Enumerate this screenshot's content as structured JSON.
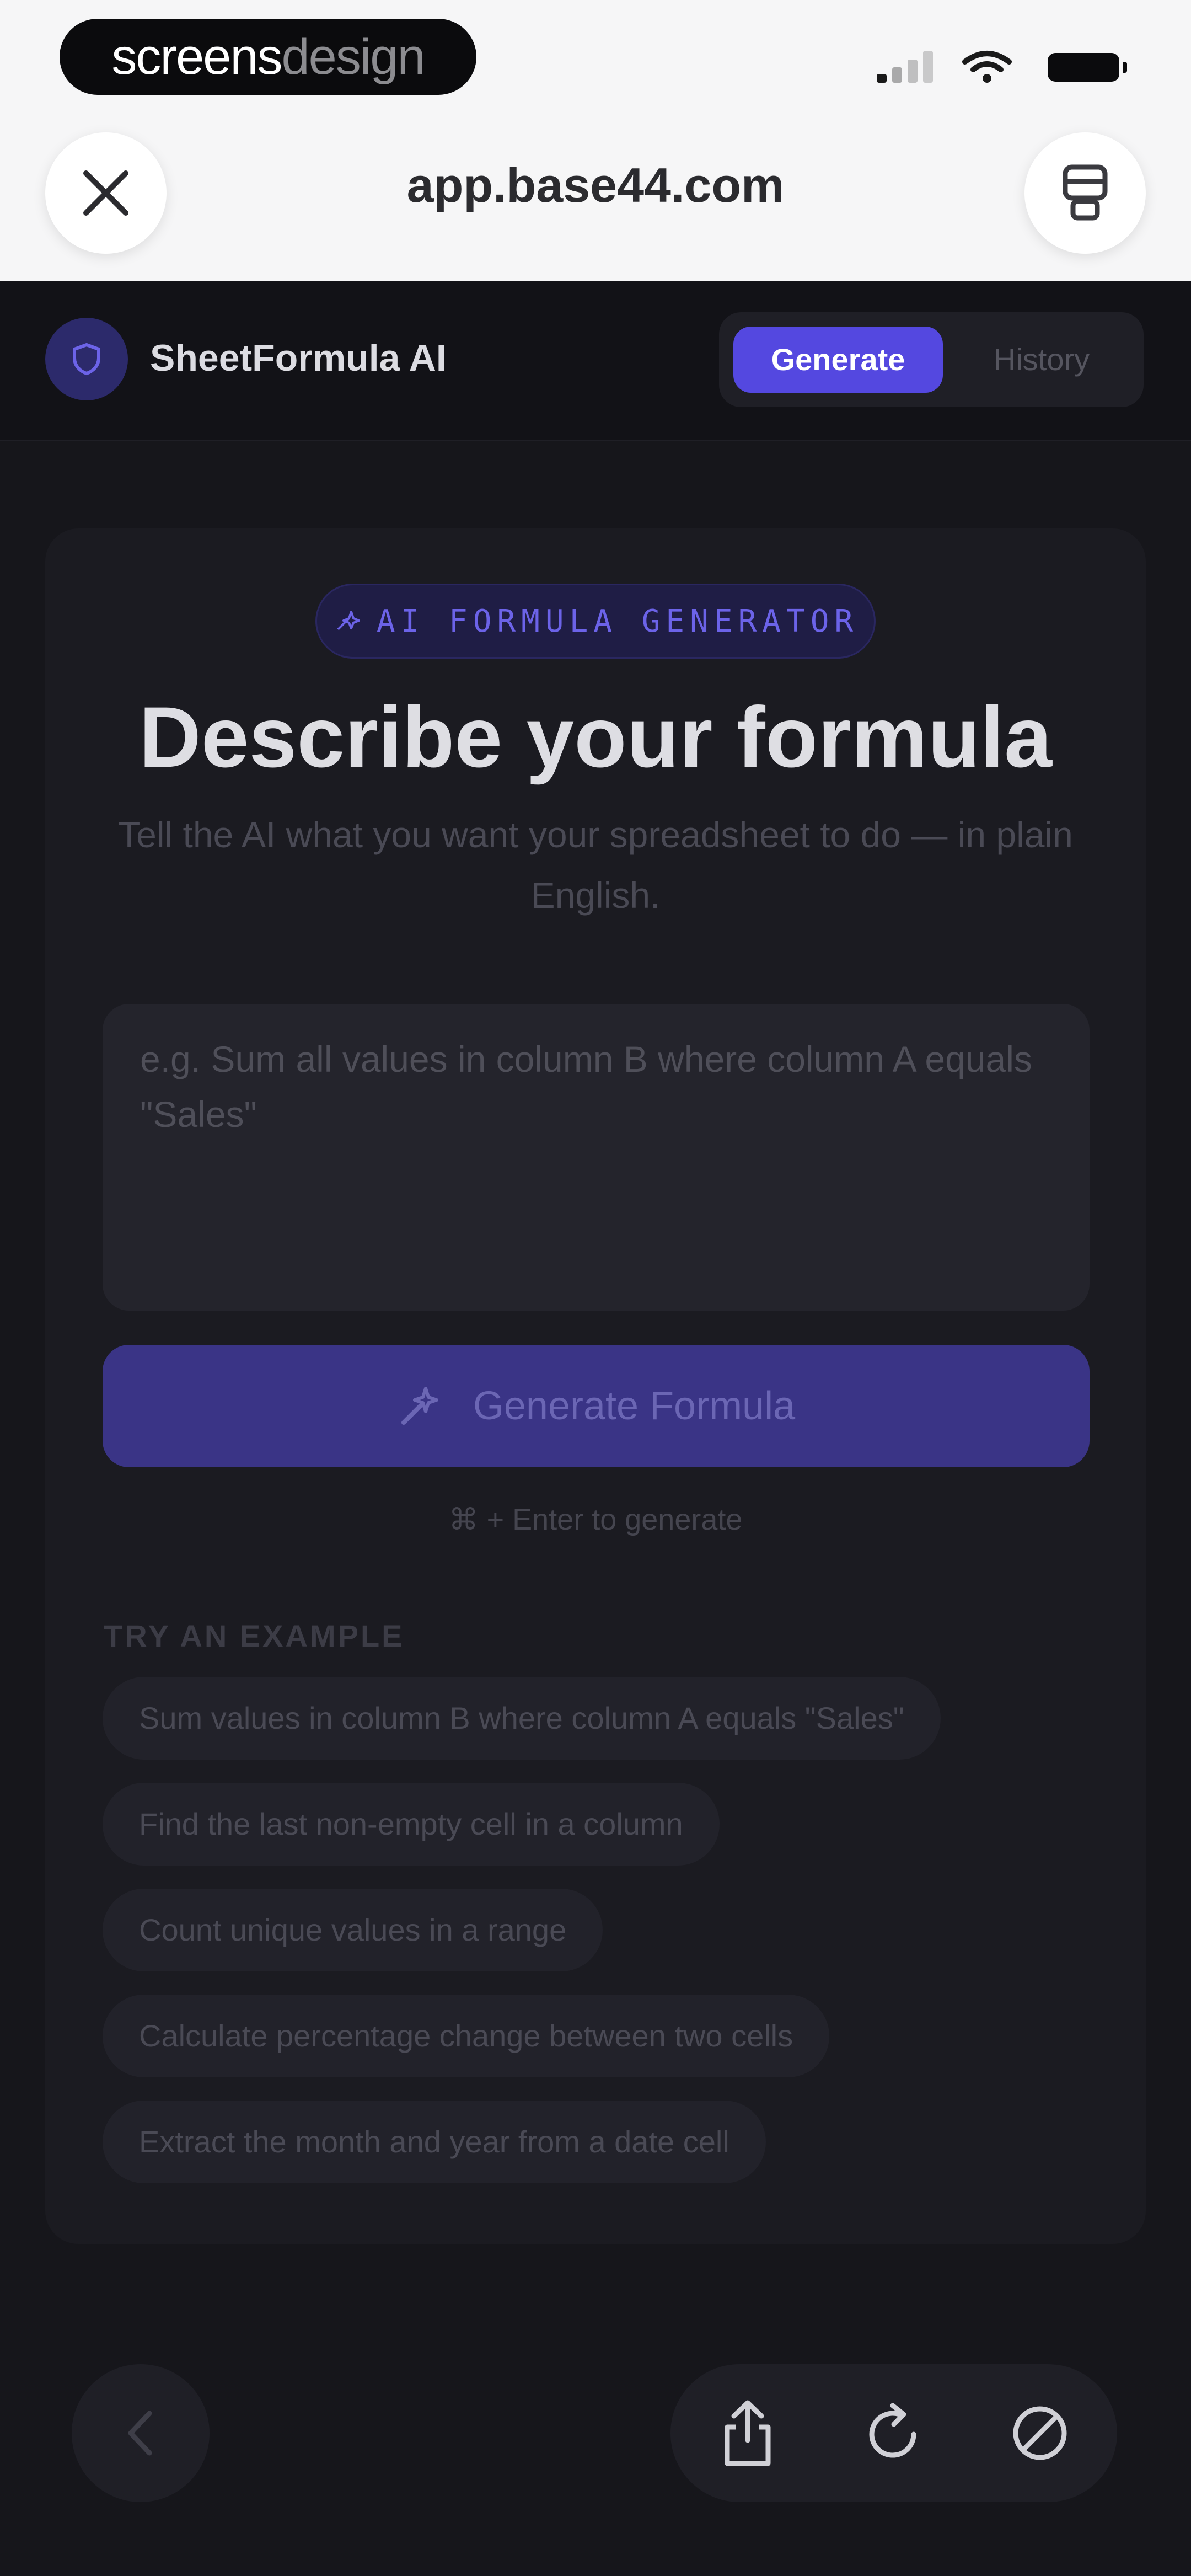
{
  "browser": {
    "watermark_bold": "screens",
    "watermark_light": "design",
    "url": "app.base44.com"
  },
  "app": {
    "name": "SheetFormula AI",
    "tabs": [
      {
        "label": "Generate",
        "active": true
      },
      {
        "label": "History",
        "active": false
      }
    ]
  },
  "main": {
    "badge": "AI FORMULA GENERATOR",
    "title": "Describe your formula",
    "subtitle": "Tell the AI what you want your spreadsheet to do — in plain English.",
    "input": {
      "value": "",
      "placeholder": "e.g. Sum all values in column B where column A equals \"Sales\""
    },
    "generate_label": "Generate Formula",
    "shortcut_hint": "⌘ + Enter to generate",
    "examples_label": "TRY AN EXAMPLE",
    "examples": [
      "Sum values in column B where column A equals \"Sales\"",
      "Find the last non-empty cell in a column",
      "Count unique values in a range",
      "Calculate percentage change between two cells",
      "Extract the month and year from a date cell"
    ]
  },
  "colors": {
    "accent": "#5448e0",
    "background": "#16161b",
    "card": "#1b1b21"
  }
}
